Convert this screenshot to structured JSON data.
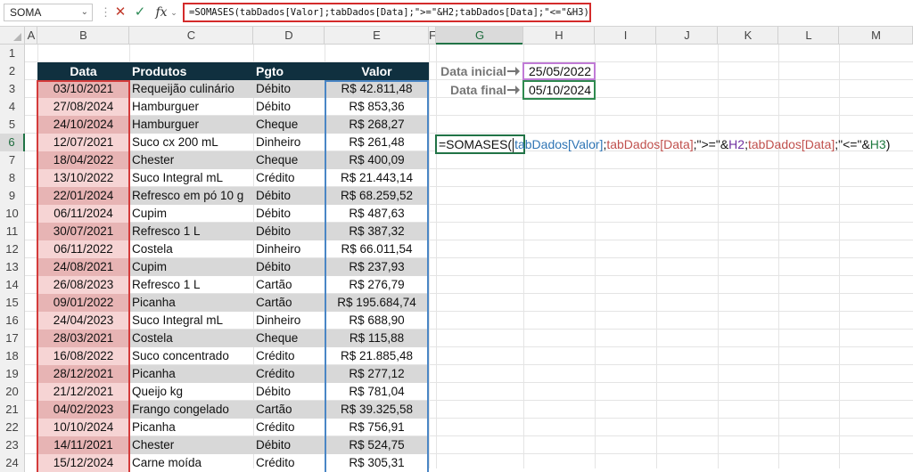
{
  "formula_bar": {
    "name_box": "SOMA",
    "cancel_icon": "✕",
    "enter_icon": "✓",
    "fx_label": "fx",
    "formula": "=SOMASES(tabDados[Valor];tabDados[Data];\">=\"&H2;tabDados[Data];\"<=\"&H3)"
  },
  "columns": [
    "A",
    "B",
    "C",
    "D",
    "E",
    "F",
    "G",
    "H",
    "I",
    "J",
    "K",
    "L",
    "M"
  ],
  "selected_column": "G",
  "selected_row": "6",
  "rows": [
    "1",
    "2",
    "3",
    "4",
    "5",
    "6",
    "7",
    "8",
    "9",
    "10",
    "11",
    "12",
    "13",
    "14",
    "15",
    "16",
    "17",
    "18",
    "19",
    "20",
    "21",
    "22",
    "23",
    "24"
  ],
  "table": {
    "headers": [
      "Data",
      "Produtos",
      "Pgto",
      "Valor"
    ],
    "rows": [
      [
        "03/10/2021",
        "Requeijão culinário",
        "Débito",
        "R$ 42.811,48"
      ],
      [
        "27/08/2024",
        "Hamburguer",
        "Débito",
        "R$ 853,36"
      ],
      [
        "24/10/2024",
        "Hamburguer",
        "Cheque",
        "R$ 268,27"
      ],
      [
        "12/07/2021",
        "Suco cx 200 mL",
        "Dinheiro",
        "R$ 261,48"
      ],
      [
        "18/04/2022",
        "Chester",
        "Cheque",
        "R$ 400,09"
      ],
      [
        "13/10/2022",
        "Suco Integral mL",
        "Crédito",
        "R$ 21.443,14"
      ],
      [
        "22/01/2024",
        "Refresco em pó 10 g",
        "Débito",
        "R$ 68.259,52"
      ],
      [
        "06/11/2024",
        "Cupim",
        "Débito",
        "R$ 487,63"
      ],
      [
        "30/07/2021",
        "Refresco 1 L",
        "Débito",
        "R$ 387,32"
      ],
      [
        "06/11/2022",
        "Costela",
        "Dinheiro",
        "R$ 66.011,54"
      ],
      [
        "24/08/2021",
        "Cupim",
        "Débito",
        "R$ 237,93"
      ],
      [
        "26/08/2023",
        "Refresco 1 L",
        "Cartão",
        "R$ 276,79"
      ],
      [
        "09/01/2022",
        "Picanha",
        "Cartão",
        "R$ 195.684,74"
      ],
      [
        "24/04/2023",
        "Suco Integral mL",
        "Dinheiro",
        "R$ 688,90"
      ],
      [
        "28/03/2021",
        "Costela",
        "Cheque",
        "R$ 115,88"
      ],
      [
        "16/08/2022",
        "Suco concentrado",
        "Crédito",
        "R$ 21.885,48"
      ],
      [
        "28/12/2021",
        "Picanha",
        "Crédito",
        "R$ 277,12"
      ],
      [
        "21/12/2021",
        "Queijo kg",
        "Débito",
        "R$ 781,04"
      ],
      [
        "04/02/2023",
        "Frango congelado",
        "Cartão",
        "R$ 39.325,58"
      ],
      [
        "10/10/2024",
        "Picanha",
        "Crédito",
        "R$ 756,91"
      ],
      [
        "14/11/2021",
        "Chester",
        "Débito",
        "R$ 524,75"
      ],
      [
        "15/12/2024",
        "Carne moída",
        "Crédito",
        "R$ 305,31"
      ]
    ]
  },
  "criteria": {
    "start_label": "Data inicial",
    "start_value": "25/05/2022",
    "end_label": "Data final",
    "end_value": "05/10/2024"
  },
  "cell_g6": {
    "fn": "=SOMASES(",
    "arg1": "tabDados[Valor]",
    "sep1": ";",
    "arg2": "tabDados[Data]",
    "op1": ";\">=\"&",
    "ref1": "H2",
    "sep2": ";",
    "arg3": "tabDados[Data]",
    "op2": ";\"<=\"&",
    "ref2": "H3",
    "close": ")"
  },
  "colors": {
    "header_bg": "#10303f",
    "date_highlight": "#d43b3b",
    "value_highlight": "#4a86c5",
    "h2_highlight": "#c07bd6",
    "h3_highlight": "#2f8a4f",
    "formula_box": "#d42b2b"
  }
}
